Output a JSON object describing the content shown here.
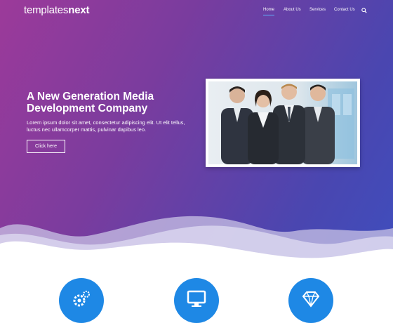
{
  "brand": {
    "logo_light": "templates",
    "logo_bold": "next"
  },
  "nav": {
    "items": [
      {
        "label": "Home",
        "active": true
      },
      {
        "label": "About Us",
        "active": false
      },
      {
        "label": "Services",
        "active": false
      },
      {
        "label": "Contact Us",
        "active": false
      }
    ],
    "search_icon": "search-icon"
  },
  "hero": {
    "headline": "A New Generation Media Development Company",
    "subtext": "Lorem ipsum dolor sit amet, consectetur adipiscing elit. Ut elit tellus, luctus nec ullamcorper mattis, pulvinar dapibus leo.",
    "cta_label": "Click here",
    "image": "business-team-photo"
  },
  "features": [
    {
      "icon": "gears-icon"
    },
    {
      "icon": "monitor-icon"
    },
    {
      "icon": "diamond-icon"
    }
  ],
  "colors": {
    "gradient_start": "#9c3a9a",
    "gradient_end": "#3d4fbf",
    "accent": "#1e88e5",
    "nav_active_underline": "#5fb3ff"
  }
}
